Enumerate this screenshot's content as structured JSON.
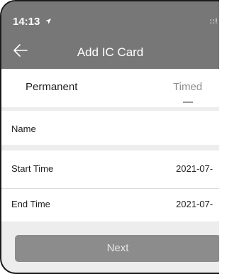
{
  "status_bar": {
    "time": "14:13",
    "location_icon": "location-arrow-icon",
    "signal": "::!"
  },
  "header": {
    "back_icon": "back-arrow-icon",
    "title": "Add IC Card"
  },
  "tabs": [
    {
      "label": "Permanent",
      "active": true
    },
    {
      "label": "Timed",
      "active": false
    }
  ],
  "form": {
    "name_label": "Name",
    "name_value": "",
    "start_time_label": "Start Time",
    "start_time_value": "2021-07-",
    "end_time_label": "End Time",
    "end_time_value": "2021-07-"
  },
  "footer": {
    "next_label": "Next"
  },
  "colors": {
    "header_bg": "#777777",
    "button_bg": "#8c8c8c",
    "page_bg": "#ededed"
  }
}
